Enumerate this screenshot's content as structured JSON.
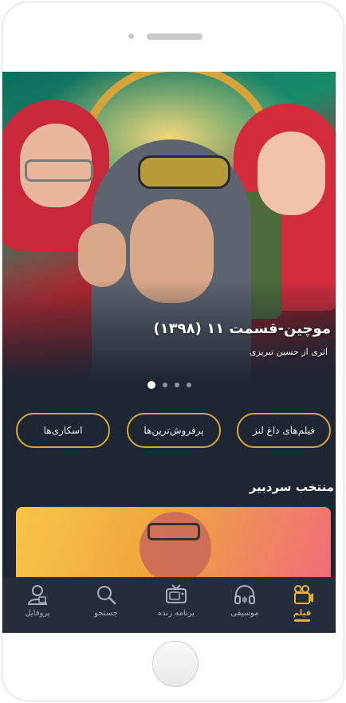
{
  "hero": {
    "title": "موچین-قسمت ۱۱ (۱۳۹۸)",
    "subtitle": "اثری از حسین تبریزی",
    "slide_count": 4,
    "active_slide": 1
  },
  "chips": [
    {
      "label": "فیلم‌های داغ لنز"
    },
    {
      "label": "پرفروش‌ترین‌ها"
    },
    {
      "label": "اسکاری‌ها"
    }
  ],
  "section": {
    "title": "منتخب سردبیر"
  },
  "tabbar": {
    "items": [
      {
        "label": "فیلم",
        "icon": "film-camera-icon",
        "active": true
      },
      {
        "label": "موسیقی",
        "icon": "headphones-icon",
        "active": false
      },
      {
        "label": "برنامه زنده",
        "icon": "tv-icon",
        "active": false
      },
      {
        "label": "جستجو",
        "icon": "search-icon",
        "active": false
      },
      {
        "label": "پروفایل",
        "icon": "profile-icon",
        "active": false
      }
    ]
  },
  "colors": {
    "accent": "#e5b23f",
    "background": "#1e2533",
    "tabbar": "#252d3d"
  }
}
